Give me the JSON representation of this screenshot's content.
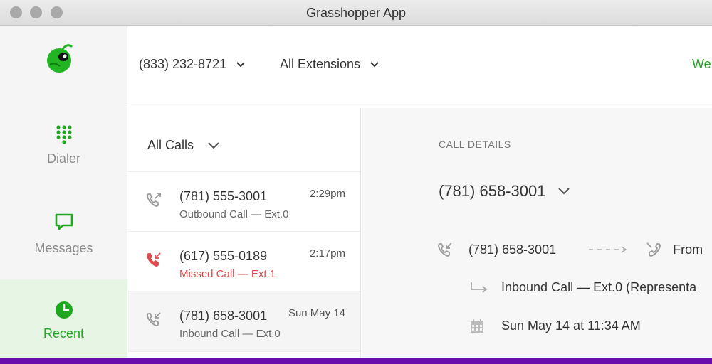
{
  "window": {
    "title": "Grasshopper App"
  },
  "sidebar": {
    "logo_icon": "grasshopper-logo-icon",
    "items": [
      {
        "label": "Dialer",
        "icon": "dialpad-icon",
        "active": false
      },
      {
        "label": "Messages",
        "icon": "message-icon",
        "active": false
      },
      {
        "label": "Recent",
        "icon": "clock-icon",
        "active": true
      }
    ]
  },
  "header": {
    "phone_number": "(833) 232-8721",
    "extensions": "All Extensions",
    "right_text": "We"
  },
  "calllist": {
    "filter": "All Calls",
    "calls": [
      {
        "number": "(781) 555-3001",
        "time": "2:29pm",
        "detail": "Outbound Call — Ext.0",
        "type": "outbound"
      },
      {
        "number": "(617) 555-0189",
        "time": "2:17pm",
        "detail": "Missed Call — Ext.1",
        "type": "missed"
      },
      {
        "number": "(781) 658-3001",
        "time": "Sun May 14",
        "detail": "Inbound Call — Ext.0",
        "type": "inbound"
      }
    ]
  },
  "details": {
    "label": "CALL DETAILS",
    "number": "(781) 658-3001",
    "from_number": "(781) 658-3001",
    "from_label": "From",
    "route": "Inbound Call — Ext.0 (Representa",
    "datetime": "Sun May 14 at 11:34 AM"
  },
  "colors": {
    "brand_green": "#1fa81f",
    "missed_red": "#e0474c",
    "bottom_bar": "#6a0dad"
  }
}
